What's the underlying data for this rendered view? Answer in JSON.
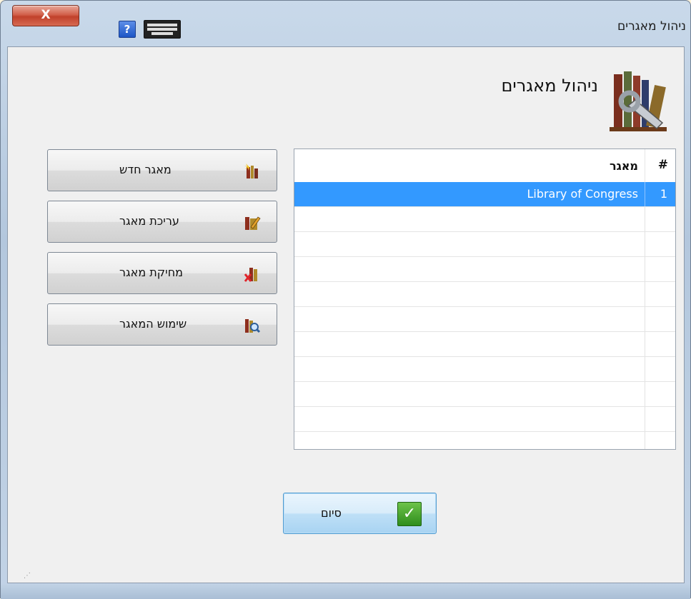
{
  "window": {
    "title": "ניהול מאגרים",
    "close_label": "X",
    "help_label": "?"
  },
  "header": {
    "title": "ניהול מאגרים"
  },
  "grid": {
    "columns": {
      "num": "#",
      "name": "מאגר"
    },
    "rows": [
      {
        "num": "1",
        "name": "Library of Congress",
        "selected": true
      }
    ],
    "empty_rows": 10
  },
  "actions": [
    {
      "label": "מאגר חדש",
      "icon": "new-library-icon"
    },
    {
      "label": "עריכת מאגר",
      "icon": "edit-library-icon"
    },
    {
      "label": "מחיקת מאגר",
      "icon": "delete-library-icon"
    },
    {
      "label": "שימוש המאגר",
      "icon": "use-library-icon"
    }
  ],
  "footer": {
    "finish_label": "סיום"
  },
  "colors": {
    "selection": "#3399ff",
    "close": "#c0412b",
    "check": "#2f8d1d"
  }
}
